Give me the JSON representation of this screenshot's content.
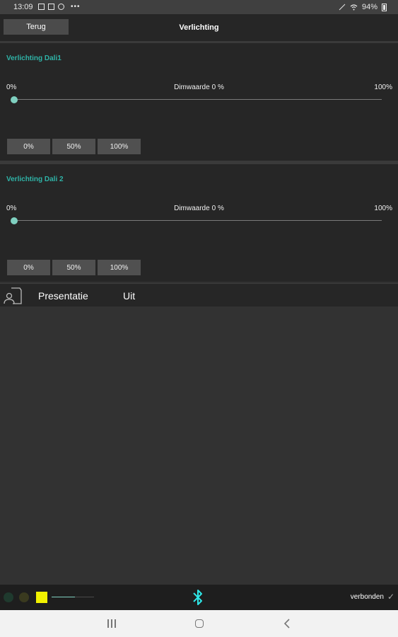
{
  "status_bar": {
    "time": "13:09",
    "battery": "94%"
  },
  "header": {
    "back_label": "Terug",
    "title": "Verlichting"
  },
  "panels": [
    {
      "title": "Verlichting Dali1",
      "min_label": "0%",
      "dim_label": "Dimwaarde",
      "dim_value": "0 %",
      "max_label": "100%",
      "slider_value_percent": 0,
      "presets": [
        "0%",
        "50%",
        "100%"
      ]
    },
    {
      "title": "Verlichting Dali 2",
      "min_label": "0%",
      "dim_label": "Dimwaarde",
      "dim_value": "0 %",
      "max_label": "100%",
      "slider_value_percent": 0,
      "presets": [
        "0%",
        "50%",
        "100%"
      ]
    }
  ],
  "presentatie": {
    "icon": "presentation-person-icon",
    "label": "Presentatie",
    "value": "Uit"
  },
  "bottom_bar": {
    "leds": [
      {
        "name": "green-led",
        "color": "#1f3a2e"
      },
      {
        "name": "olive-led",
        "color": "#3a3a1f"
      },
      {
        "name": "yellow-indicator",
        "color": "#f2f200"
      }
    ],
    "level_percent": 55,
    "bluetooth_color": "#2ee6e6",
    "connection_status": "verbonden"
  },
  "colors": {
    "accent": "#2fb3a7",
    "background": "#323232",
    "panel": "#262626"
  }
}
